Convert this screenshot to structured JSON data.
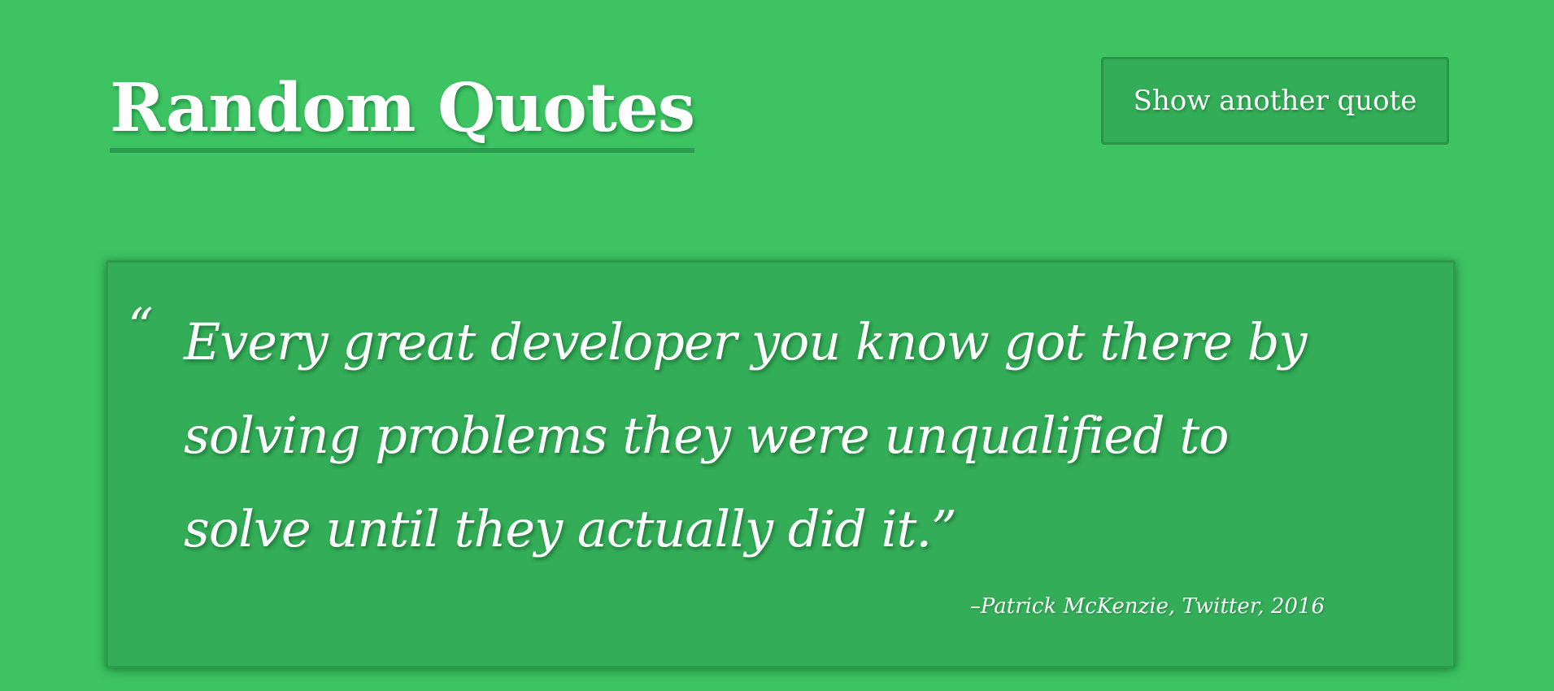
{
  "header": {
    "title": "Random Quotes",
    "next_button_label": "Show another quote"
  },
  "quote": {
    "open_mark": "“",
    "text": "Every great developer you know got there by solving problems they were unqualified to solve until they actually did it.",
    "close_mark": "”",
    "attribution": "–Patrick McKenzie, Twitter, 2016"
  },
  "colors": {
    "background": "#3dc362",
    "card": "#33ad57",
    "border": "#2a9449",
    "text": "#ffffff"
  }
}
